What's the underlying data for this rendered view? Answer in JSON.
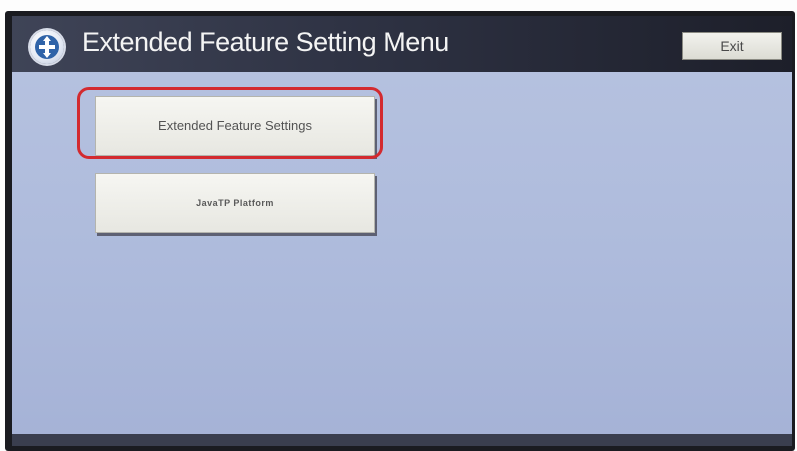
{
  "header": {
    "title": "Extended Feature Setting Menu",
    "exit_label": "Exit",
    "icon": "menu-app-icon"
  },
  "menu": {
    "items": [
      {
        "label": "Extended Feature Settings",
        "highlighted": true
      },
      {
        "label": "JavaTP Platform",
        "highlighted": false
      }
    ]
  },
  "colors": {
    "header_bg": "#2e3243",
    "screen_bg": "#b7c3e0",
    "highlight": "#d32a2f",
    "button_bg": "#f6f6f2"
  }
}
